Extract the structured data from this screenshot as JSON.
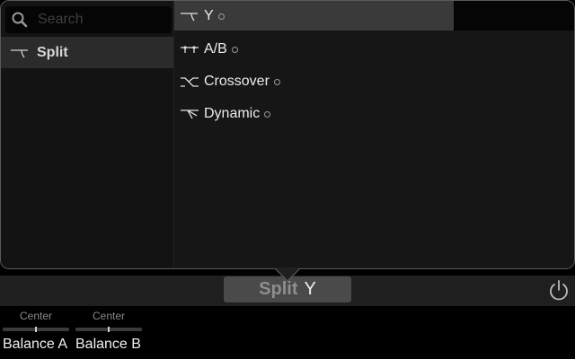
{
  "search": {
    "placeholder": "Search"
  },
  "categories": [
    {
      "label": "Split",
      "icon": "split-y-icon",
      "selected": true
    }
  ],
  "routing_types": [
    {
      "label": "Y",
      "icon": "split-y-icon",
      "selected": true
    },
    {
      "label": "A/B",
      "icon": "split-ab-icon",
      "selected": false
    },
    {
      "label": "Crossover",
      "icon": "crossover-icon",
      "selected": false
    },
    {
      "label": "Dynamic",
      "icon": "dynamic-icon",
      "selected": false
    }
  ],
  "mode_button": {
    "category": "Split",
    "type": "Y"
  },
  "power": {
    "icon": "power-icon"
  },
  "knobs": [
    {
      "name": "Balance A",
      "value": "Center",
      "position": 0.5
    },
    {
      "name": "Balance B",
      "value": "Center",
      "position": 0.5
    }
  ],
  "colors": {
    "panel": "#161616",
    "selected_row": "#3a3a3a",
    "category_row": "#2b2b2b",
    "button": "#4a4a4a"
  }
}
